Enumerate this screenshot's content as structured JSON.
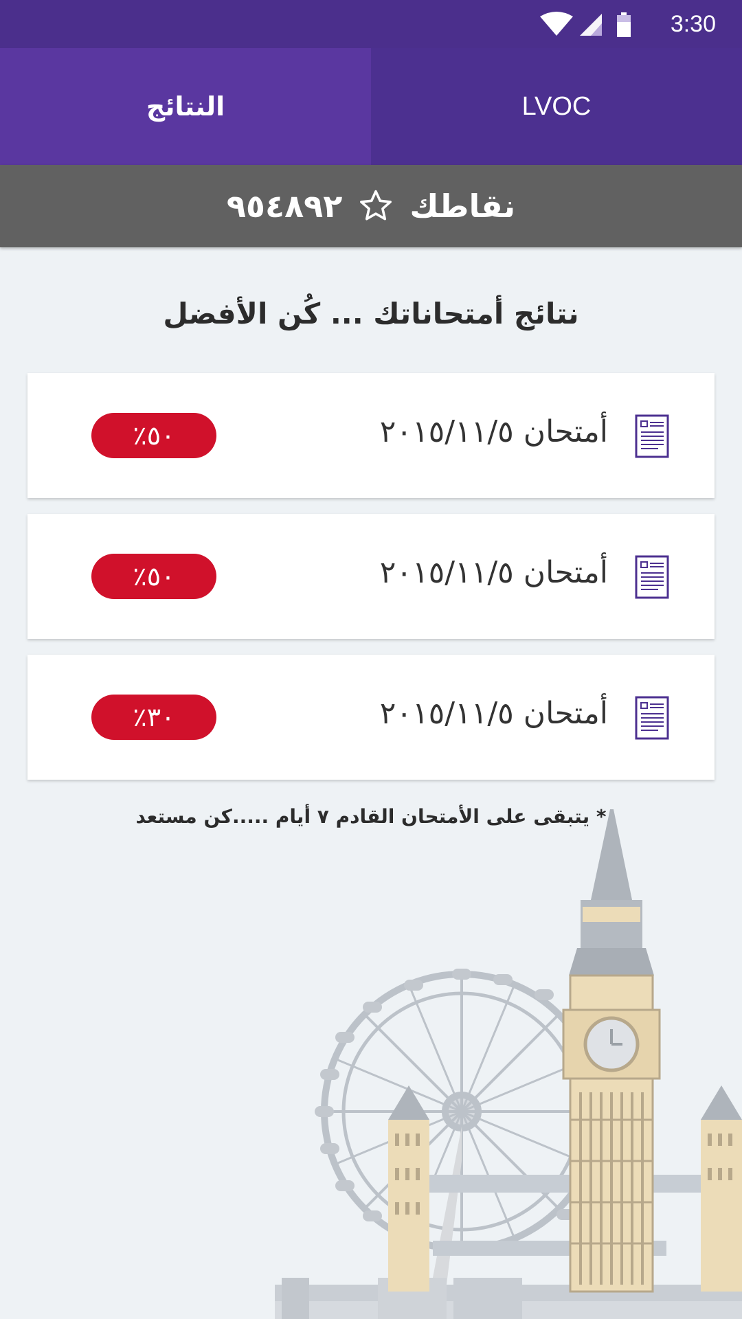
{
  "status_bar": {
    "time": "3:30",
    "icons": [
      "wifi-icon",
      "signal-icon",
      "battery-icon"
    ]
  },
  "tabs": [
    {
      "label": "النتائج",
      "active": true
    },
    {
      "label": "LVOC",
      "active": false
    }
  ],
  "points": {
    "label": "نقاطك",
    "icon": "star-outline-icon",
    "value": "٩٥٤٨٩٢"
  },
  "headline": "نتائج أمتحاناتك ... كُن الأفضل",
  "results": [
    {
      "title": "أمتحان ٢٠١٥/١١/٥",
      "score": "٥٠٪",
      "icon": "document-icon"
    },
    {
      "title": "أمتحان ٢٠١٥/١١/٥",
      "score": "٥٠٪",
      "icon": "document-icon"
    },
    {
      "title": "أمتحان ٢٠١٥/١١/٥",
      "score": "٣٠٪",
      "icon": "document-icon"
    }
  ],
  "footnote": "* يتبقى على الأمتحان القادم ٧ أيام .....كن مستعد",
  "colors": {
    "primary": "#4c3090",
    "active_tab": "#5a37a0",
    "points_bar": "#616161",
    "badge": "#d0112b",
    "background": "#eef2f5"
  }
}
